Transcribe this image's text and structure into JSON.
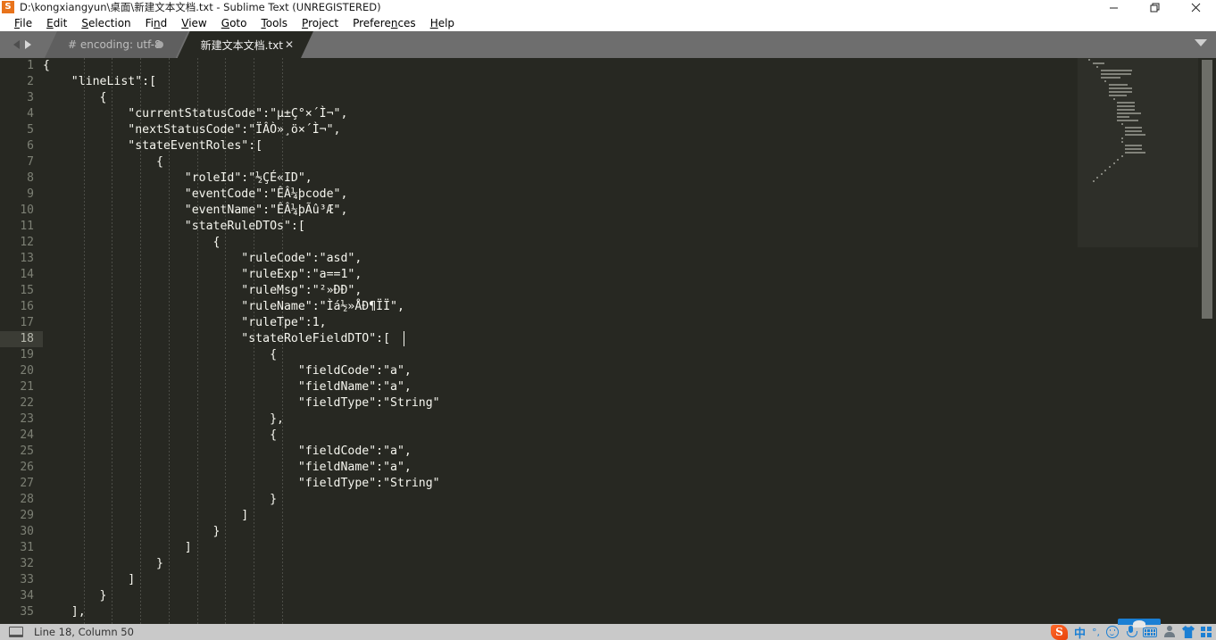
{
  "window": {
    "title": "D:\\kongxiangyun\\桌面\\新建文本文档.txt - Sublime Text (UNREGISTERED)",
    "app_icon_glyph": "S",
    "controls": {
      "minimize": "minimize-icon",
      "restore": "restore-icon",
      "close": "close-icon"
    }
  },
  "menubar": {
    "items": [
      {
        "label": "File",
        "mnemonic": "F",
        "pre": "",
        "post": "ile"
      },
      {
        "label": "Edit",
        "mnemonic": "E",
        "pre": "",
        "post": "dit"
      },
      {
        "label": "Selection",
        "mnemonic": "S",
        "pre": "",
        "post": "election"
      },
      {
        "label": "Find",
        "mnemonic": "n",
        "pre": "Fi",
        "post": "d"
      },
      {
        "label": "View",
        "mnemonic": "V",
        "pre": "",
        "post": "iew"
      },
      {
        "label": "Goto",
        "mnemonic": "G",
        "pre": "",
        "post": "oto"
      },
      {
        "label": "Tools",
        "mnemonic": "T",
        "pre": "",
        "post": "ools"
      },
      {
        "label": "Project",
        "mnemonic": "P",
        "pre": "",
        "post": "roject"
      },
      {
        "label": "Preferences",
        "mnemonic": "n",
        "pre": "Prefere",
        "post": "ces"
      },
      {
        "label": "Help",
        "mnemonic": "H",
        "pre": "",
        "post": "elp"
      }
    ]
  },
  "tabs": [
    {
      "label": "# encoding: utf-8",
      "active": false,
      "modified": true,
      "close_glyph": ""
    },
    {
      "label": "新建文本文档.txt",
      "active": true,
      "modified": false,
      "close_glyph": "✕"
    }
  ],
  "tabbar": {
    "nav_prev": "◀",
    "nav_next": "▶",
    "dropdown": "chevron-down-icon"
  },
  "editor": {
    "first_line": 1,
    "lines": [
      {
        "n": 1,
        "text": "{"
      },
      {
        "n": 2,
        "text": "    \"lineList\":["
      },
      {
        "n": 3,
        "text": "        {"
      },
      {
        "n": 4,
        "text": "            \"currentStatusCode\":\"µ±Ç°×´Ì¬\","
      },
      {
        "n": 5,
        "text": "            \"nextStatusCode\":\"ÏÂÒ»¸ö×´Ì¬\","
      },
      {
        "n": 6,
        "text": "            \"stateEventRoles\":["
      },
      {
        "n": 7,
        "text": "                {"
      },
      {
        "n": 8,
        "text": "                    \"roleId\":\"½ÇÉ«ID\","
      },
      {
        "n": 9,
        "text": "                    \"eventCode\":\"ÊÂ¼þcode\","
      },
      {
        "n": 10,
        "text": "                    \"eventName\":\"ÊÂ¼þÃû³Æ\","
      },
      {
        "n": 11,
        "text": "                    \"stateRuleDTOs\":["
      },
      {
        "n": 12,
        "text": "                        {"
      },
      {
        "n": 13,
        "text": "                            \"ruleCode\":\"asd\","
      },
      {
        "n": 14,
        "text": "                            \"ruleExp\":\"a==1\","
      },
      {
        "n": 15,
        "text": "                            \"ruleMsg\":\"²»ÐÐ\","
      },
      {
        "n": 16,
        "text": "                            \"ruleName\":\"Ìá½»ÅÐ¶ÏÏ\","
      },
      {
        "n": 17,
        "text": "                            \"ruleTpe\":1,"
      },
      {
        "n": 18,
        "text": "                            \"stateRoleFieldDTO\":["
      },
      {
        "n": 19,
        "text": "                                {"
      },
      {
        "n": 20,
        "text": "                                    \"fieldCode\":\"a\","
      },
      {
        "n": 21,
        "text": "                                    \"fieldName\":\"a\","
      },
      {
        "n": 22,
        "text": "                                    \"fieldType\":\"String\""
      },
      {
        "n": 23,
        "text": "                                },"
      },
      {
        "n": 24,
        "text": "                                {"
      },
      {
        "n": 25,
        "text": "                                    \"fieldCode\":\"a\","
      },
      {
        "n": 26,
        "text": "                                    \"fieldName\":\"a\","
      },
      {
        "n": 27,
        "text": "                                    \"fieldType\":\"String\""
      },
      {
        "n": 28,
        "text": "                                }"
      },
      {
        "n": 29,
        "text": "                            ]"
      },
      {
        "n": 30,
        "text": "                        }"
      },
      {
        "n": 31,
        "text": "                    ]"
      },
      {
        "n": 32,
        "text": "                }"
      },
      {
        "n": 33,
        "text": "            ]"
      },
      {
        "n": 34,
        "text": "        }"
      },
      {
        "n": 35,
        "text": "    ],"
      }
    ],
    "current_line": 18,
    "cursor": {
      "line": 18,
      "column": 50
    }
  },
  "statusbar": {
    "position_label": "Line 18, Column 50"
  },
  "taskbar": {
    "tray": [
      {
        "name": "sogou-ime-icon",
        "glyph": "S"
      },
      {
        "name": "ime-chinese-icon",
        "glyph": "中"
      },
      {
        "name": "ime-punctuation-icon",
        "glyph": "°,"
      },
      {
        "name": "ime-emoji-icon",
        "glyph": "smile"
      },
      {
        "name": "ime-voice-icon",
        "glyph": "mic"
      },
      {
        "name": "ime-keyboard-icon",
        "glyph": "keyboard"
      },
      {
        "name": "ime-user-icon",
        "glyph": "person"
      },
      {
        "name": "ime-skin-icon",
        "glyph": "shirt"
      },
      {
        "name": "ime-toolbox-icon",
        "glyph": "squares"
      }
    ]
  },
  "colors": {
    "editor_bg": "#272822",
    "tabbar_bg": "#6e6e6e",
    "titlebar_bg": "#ffffff",
    "taskbar_bg": "#c9c9c9",
    "gutter_fg": "#7d8075",
    "code_fg": "#f6f6ef",
    "accent_orange": "#e8731b",
    "accent_blue": "#1b7fd4"
  }
}
